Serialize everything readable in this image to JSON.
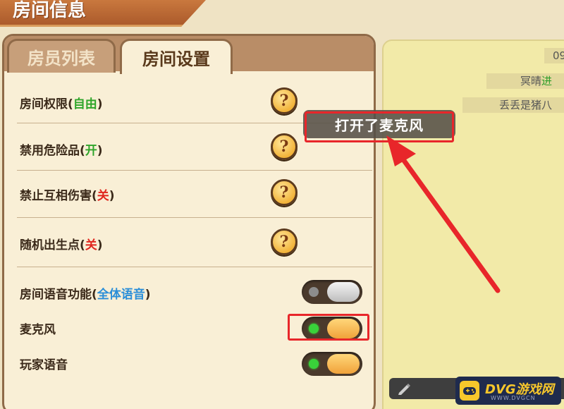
{
  "title": "房间信息",
  "tabs": [
    {
      "label": "房员列表",
      "active": false
    },
    {
      "label": "房间设置",
      "active": true
    }
  ],
  "settings": [
    {
      "label": "房间权限",
      "state": "自由",
      "state_color": "green",
      "control": "help"
    },
    {
      "label": "禁用危险品",
      "state": "开",
      "state_color": "green",
      "control": "help"
    },
    {
      "label": "禁止互相伤害",
      "state": "关",
      "state_color": "red",
      "control": "help"
    },
    {
      "label": "随机出生点",
      "state": "关",
      "state_color": "red",
      "control": "help"
    },
    {
      "label": "房间语音功能",
      "state": "全体语音",
      "state_color": "blue",
      "control": "toggle",
      "toggle_on": false
    },
    {
      "label": "麦克风",
      "state": "",
      "control": "toggle",
      "toggle_on": true
    },
    {
      "label": "玩家语音",
      "state": "",
      "control": "toggle",
      "toggle_on": true
    }
  ],
  "paren_open": "(",
  "paren_close": ")",
  "help_glyph": "?",
  "toast": "打开了麦克风",
  "chat": {
    "time": "09",
    "messages": [
      {
        "text": "冥晴",
        "accent": "进"
      },
      {
        "text": "丢丢是猪八",
        "accent": ""
      }
    ]
  },
  "watermark": {
    "brand": "DVG游戏网",
    "url": "WWW.DVGCN"
  },
  "colors": {
    "green": "#2fa52a",
    "red": "#e0261e",
    "blue": "#2a8ed8",
    "annotation_red": "#e8262a",
    "toggle_on_knob": "#f0a23a",
    "toggle_off_knob": "#d0d0d0"
  },
  "icons": [
    "help-icon",
    "pencil-icon",
    "gamepad-logo-icon",
    "annotation-arrow"
  ]
}
